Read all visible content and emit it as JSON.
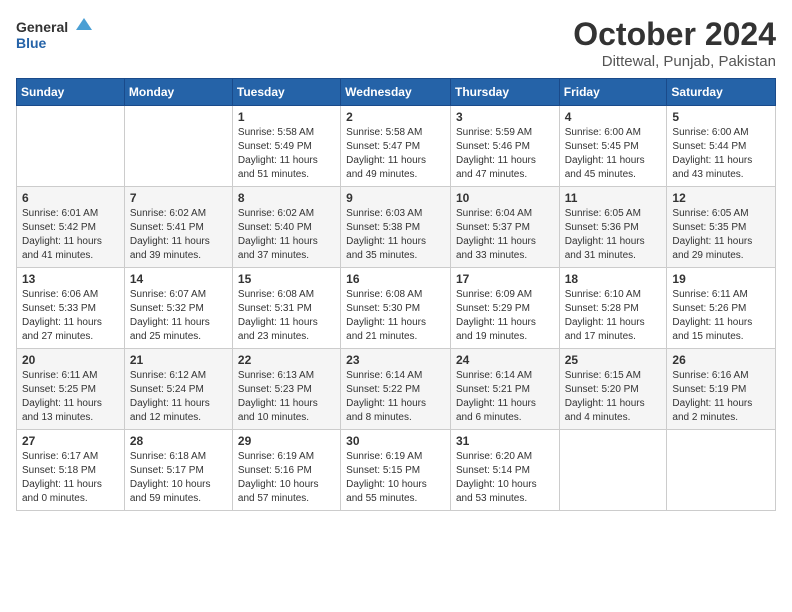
{
  "header": {
    "logo_general": "General",
    "logo_blue": "Blue",
    "title": "October 2024",
    "location": "Dittewal, Punjab, Pakistan"
  },
  "days_of_week": [
    "Sunday",
    "Monday",
    "Tuesday",
    "Wednesday",
    "Thursday",
    "Friday",
    "Saturday"
  ],
  "weeks": [
    [
      {
        "day": "",
        "content": ""
      },
      {
        "day": "",
        "content": ""
      },
      {
        "day": "1",
        "content": "Sunrise: 5:58 AM\nSunset: 5:49 PM\nDaylight: 11 hours and 51 minutes."
      },
      {
        "day": "2",
        "content": "Sunrise: 5:58 AM\nSunset: 5:47 PM\nDaylight: 11 hours and 49 minutes."
      },
      {
        "day": "3",
        "content": "Sunrise: 5:59 AM\nSunset: 5:46 PM\nDaylight: 11 hours and 47 minutes."
      },
      {
        "day": "4",
        "content": "Sunrise: 6:00 AM\nSunset: 5:45 PM\nDaylight: 11 hours and 45 minutes."
      },
      {
        "day": "5",
        "content": "Sunrise: 6:00 AM\nSunset: 5:44 PM\nDaylight: 11 hours and 43 minutes."
      }
    ],
    [
      {
        "day": "6",
        "content": "Sunrise: 6:01 AM\nSunset: 5:42 PM\nDaylight: 11 hours and 41 minutes."
      },
      {
        "day": "7",
        "content": "Sunrise: 6:02 AM\nSunset: 5:41 PM\nDaylight: 11 hours and 39 minutes."
      },
      {
        "day": "8",
        "content": "Sunrise: 6:02 AM\nSunset: 5:40 PM\nDaylight: 11 hours and 37 minutes."
      },
      {
        "day": "9",
        "content": "Sunrise: 6:03 AM\nSunset: 5:38 PM\nDaylight: 11 hours and 35 minutes."
      },
      {
        "day": "10",
        "content": "Sunrise: 6:04 AM\nSunset: 5:37 PM\nDaylight: 11 hours and 33 minutes."
      },
      {
        "day": "11",
        "content": "Sunrise: 6:05 AM\nSunset: 5:36 PM\nDaylight: 11 hours and 31 minutes."
      },
      {
        "day": "12",
        "content": "Sunrise: 6:05 AM\nSunset: 5:35 PM\nDaylight: 11 hours and 29 minutes."
      }
    ],
    [
      {
        "day": "13",
        "content": "Sunrise: 6:06 AM\nSunset: 5:33 PM\nDaylight: 11 hours and 27 minutes."
      },
      {
        "day": "14",
        "content": "Sunrise: 6:07 AM\nSunset: 5:32 PM\nDaylight: 11 hours and 25 minutes."
      },
      {
        "day": "15",
        "content": "Sunrise: 6:08 AM\nSunset: 5:31 PM\nDaylight: 11 hours and 23 minutes."
      },
      {
        "day": "16",
        "content": "Sunrise: 6:08 AM\nSunset: 5:30 PM\nDaylight: 11 hours and 21 minutes."
      },
      {
        "day": "17",
        "content": "Sunrise: 6:09 AM\nSunset: 5:29 PM\nDaylight: 11 hours and 19 minutes."
      },
      {
        "day": "18",
        "content": "Sunrise: 6:10 AM\nSunset: 5:28 PM\nDaylight: 11 hours and 17 minutes."
      },
      {
        "day": "19",
        "content": "Sunrise: 6:11 AM\nSunset: 5:26 PM\nDaylight: 11 hours and 15 minutes."
      }
    ],
    [
      {
        "day": "20",
        "content": "Sunrise: 6:11 AM\nSunset: 5:25 PM\nDaylight: 11 hours and 13 minutes."
      },
      {
        "day": "21",
        "content": "Sunrise: 6:12 AM\nSunset: 5:24 PM\nDaylight: 11 hours and 12 minutes."
      },
      {
        "day": "22",
        "content": "Sunrise: 6:13 AM\nSunset: 5:23 PM\nDaylight: 11 hours and 10 minutes."
      },
      {
        "day": "23",
        "content": "Sunrise: 6:14 AM\nSunset: 5:22 PM\nDaylight: 11 hours and 8 minutes."
      },
      {
        "day": "24",
        "content": "Sunrise: 6:14 AM\nSunset: 5:21 PM\nDaylight: 11 hours and 6 minutes."
      },
      {
        "day": "25",
        "content": "Sunrise: 6:15 AM\nSunset: 5:20 PM\nDaylight: 11 hours and 4 minutes."
      },
      {
        "day": "26",
        "content": "Sunrise: 6:16 AM\nSunset: 5:19 PM\nDaylight: 11 hours and 2 minutes."
      }
    ],
    [
      {
        "day": "27",
        "content": "Sunrise: 6:17 AM\nSunset: 5:18 PM\nDaylight: 11 hours and 0 minutes."
      },
      {
        "day": "28",
        "content": "Sunrise: 6:18 AM\nSunset: 5:17 PM\nDaylight: 10 hours and 59 minutes."
      },
      {
        "day": "29",
        "content": "Sunrise: 6:19 AM\nSunset: 5:16 PM\nDaylight: 10 hours and 57 minutes."
      },
      {
        "day": "30",
        "content": "Sunrise: 6:19 AM\nSunset: 5:15 PM\nDaylight: 10 hours and 55 minutes."
      },
      {
        "day": "31",
        "content": "Sunrise: 6:20 AM\nSunset: 5:14 PM\nDaylight: 10 hours and 53 minutes."
      },
      {
        "day": "",
        "content": ""
      },
      {
        "day": "",
        "content": ""
      }
    ]
  ]
}
